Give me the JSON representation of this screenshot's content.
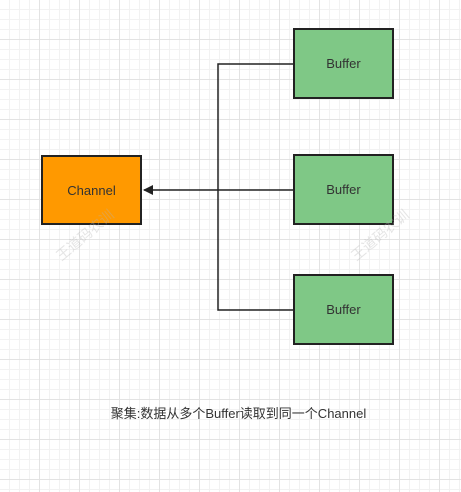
{
  "diagram": {
    "source_node": {
      "label": "Channel",
      "fill": "#ff9900"
    },
    "buffer_nodes": [
      {
        "label": "Buffer",
        "fill": "#7fc886"
      },
      {
        "label": "Buffer",
        "fill": "#7fc886"
      },
      {
        "label": "Buffer",
        "fill": "#7fc886"
      }
    ],
    "edges": [
      {
        "from": "Buffer",
        "to": "Channel"
      },
      {
        "from": "Buffer",
        "to": "Channel"
      },
      {
        "from": "Buffer",
        "to": "Channel"
      }
    ],
    "caption": "聚集:数据从多个Buffer读取到同一个Channel",
    "watermark": "王道码农训"
  }
}
